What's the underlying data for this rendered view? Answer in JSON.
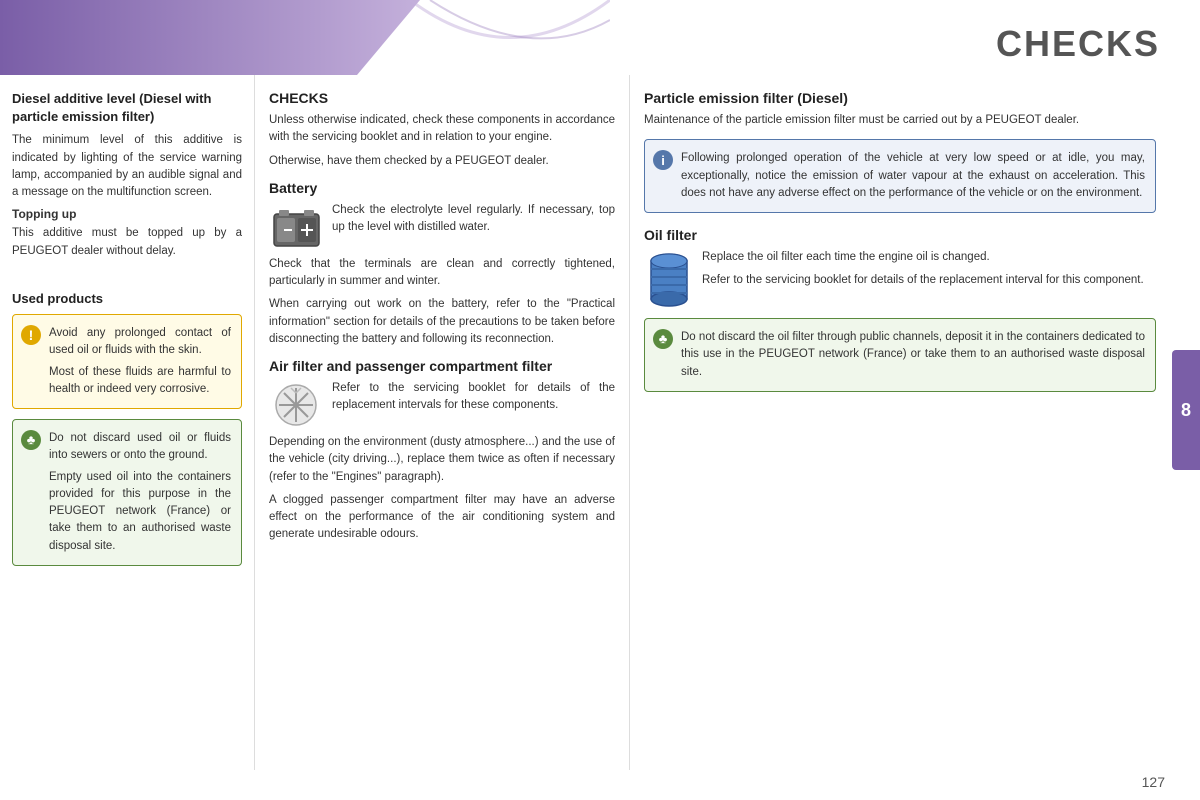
{
  "header": {
    "title": "CHECKS",
    "page_number": "127",
    "tab_number": "8"
  },
  "left_column": {
    "section1": {
      "title": "Diesel additive level (Diesel with particle emission filter)",
      "body": "The minimum level of this additive is indicated by lighting of the service warning lamp, accompanied by an audible signal and a message on the multifunction screen.",
      "subheading": "Topping up",
      "topping_text": "This additive must be topped up by a PEUGEOT dealer without delay."
    },
    "section2": {
      "title": "Used products",
      "warning_box": {
        "line1": "Avoid any prolonged contact of used oil or fluids with the skin.",
        "line2": "Most of these fluids are harmful to health or indeed very corrosive."
      },
      "eco_box": {
        "line1": "Do not discard used oil or fluids into sewers or onto the ground.",
        "line2": "Empty used oil into the containers provided for this purpose in the PEUGEOT network (France) or take them to an authorised waste disposal site."
      }
    }
  },
  "mid_column": {
    "section1": {
      "title": "CHECKS",
      "body1": "Unless otherwise indicated, check these components in accordance with the servicing booklet and in relation to your engine.",
      "body2": "Otherwise, have them checked by a PEUGEOT dealer."
    },
    "battery": {
      "title": "Battery",
      "body1": "Check the electrolyte level regularly. If necessary, top up the level with distilled water.",
      "body2": "Check that the terminals are clean and correctly tightened, particularly in summer and winter.",
      "body3": "When carrying out work on the battery, refer to the \"Practical information\" section for details of the precautions to be taken before disconnecting the battery and following its reconnection."
    },
    "air_filter": {
      "title": "Air filter and passenger compartment filter",
      "body1": "Refer to the servicing booklet for details of the replacement intervals for these components.",
      "body2": "Depending on the environment (dusty atmosphere...) and the use of the vehicle (city driving...), replace them twice as often if necessary (refer to the \"Engines\" paragraph).",
      "body3": "A clogged passenger compartment filter may have an adverse effect on the performance of the air conditioning system and generate undesirable odours."
    }
  },
  "right_column": {
    "section1": {
      "title": "Particle emission filter (Diesel)",
      "body": "Maintenance of the particle emission filter must be carried out by a PEUGEOT dealer."
    },
    "info_box": {
      "text": "Following prolonged operation of the vehicle at very low speed or at idle, you may, exceptionally, notice the emission of water vapour at the exhaust on acceleration. This does not have any adverse effect on the performance of the vehicle or on the environment."
    },
    "oil_filter": {
      "title": "Oil filter",
      "body1": "Replace the oil filter each time the engine oil is changed.",
      "body2": "Refer to the servicing booklet for details of the replacement interval for this component."
    },
    "eco_box2": {
      "text": "Do not discard the oil filter through public channels, deposit it in the containers dedicated to this use in the PEUGEOT network (France) or take them to an authorised waste disposal site."
    }
  },
  "icons": {
    "warning": "!",
    "eco": "♣",
    "info": "i"
  }
}
